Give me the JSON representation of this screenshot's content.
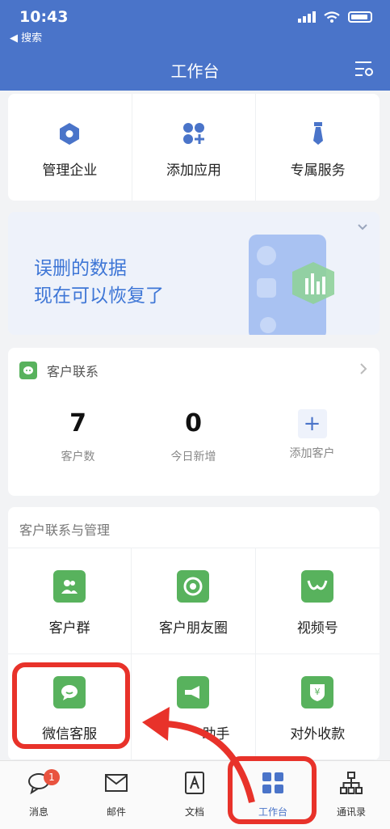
{
  "status": {
    "time": "10:43",
    "back_label": "◀ 搜索"
  },
  "header": {
    "title": "工作台"
  },
  "quick_actions": [
    {
      "label": "管理企业",
      "icon": "hexagon-icon"
    },
    {
      "label": "添加应用",
      "icon": "add-apps-icon"
    },
    {
      "label": "专属服务",
      "icon": "tie-icon"
    }
  ],
  "banner": {
    "line1": "误删的数据",
    "line2": "现在可以恢复了"
  },
  "customer_contact": {
    "title": "客户联系",
    "stats": [
      {
        "value": "7",
        "label": "客户数"
      },
      {
        "value": "0",
        "label": "今日新增"
      },
      {
        "value": "+",
        "label": "添加客户"
      }
    ]
  },
  "manage": {
    "title": "客户联系与管理",
    "items": [
      {
        "label": "客户群",
        "icon": "group-icon"
      },
      {
        "label": "客户朋友圈",
        "icon": "moments-icon"
      },
      {
        "label": "视频号",
        "icon": "channels-icon"
      },
      {
        "label": "微信客服",
        "icon": "chat-bubble-icon"
      },
      {
        "label": "助手",
        "icon": "megaphone-icon"
      },
      {
        "label": "对外收款",
        "icon": "yen-shield-icon"
      }
    ]
  },
  "tabbar": {
    "items": [
      {
        "label": "消息",
        "icon": "message-icon",
        "badge": "1"
      },
      {
        "label": "邮件",
        "icon": "mail-icon"
      },
      {
        "label": "文档",
        "icon": "document-icon"
      },
      {
        "label": "工作台",
        "icon": "workbench-icon"
      },
      {
        "label": "通讯录",
        "icon": "contacts-icon"
      }
    ]
  },
  "colors": {
    "header": "#4a74c9",
    "accent": "#3e76d6",
    "green": "#58b25d",
    "highlight": "#e8322a"
  }
}
